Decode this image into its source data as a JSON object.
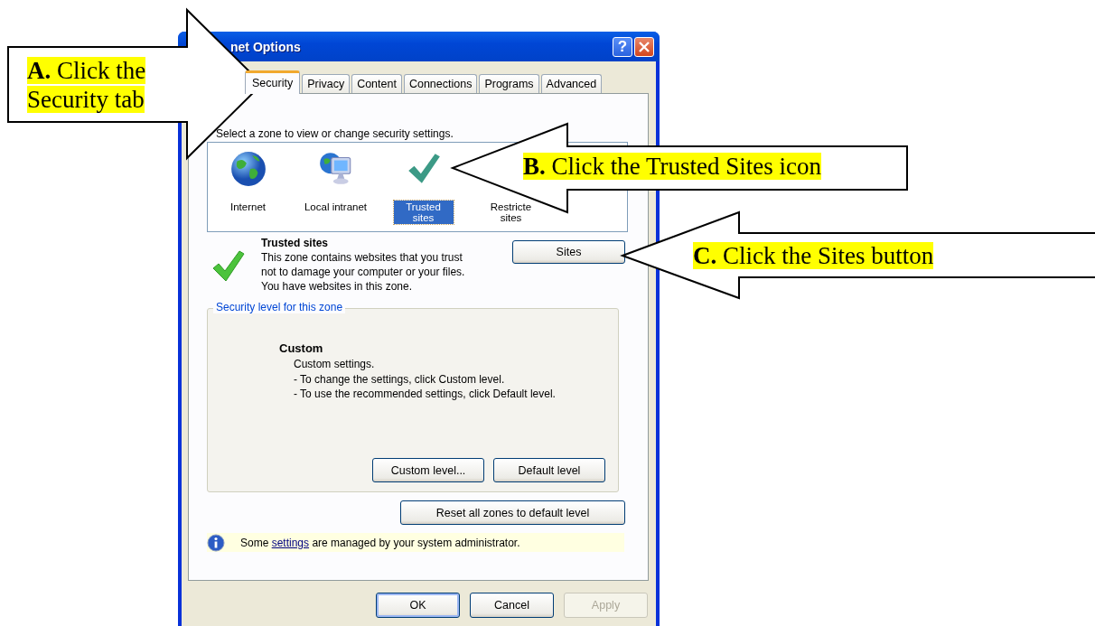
{
  "window": {
    "title": "net Options",
    "help": "?"
  },
  "tabs": [
    {
      "label": "Security",
      "selected": true
    },
    {
      "label": "Privacy",
      "selected": false
    },
    {
      "label": "Content",
      "selected": false
    },
    {
      "label": "Connections",
      "selected": false
    },
    {
      "label": "Programs",
      "selected": false
    },
    {
      "label": "Advanced",
      "selected": false
    }
  ],
  "zone_prompt": "Select a zone to view or change security settings.",
  "zones": [
    {
      "kind": "globe",
      "label": "Internet",
      "selected": false
    },
    {
      "kind": "intranet",
      "label": "Local intranet",
      "selected": false
    },
    {
      "kind": "check",
      "label": "Trusted sites",
      "selected": true
    },
    {
      "kind": "covered",
      "label": "Restricte sites",
      "selected": false
    }
  ],
  "zone_info": {
    "title": "Trusted sites",
    "description": "This zone contains websites that you trust not to damage your computer or your files.",
    "note": "You have websites in this zone.",
    "button": "Sites"
  },
  "security_level": {
    "legend": "Security level for this zone",
    "level_name": "Custom",
    "lines": [
      "Custom settings.",
      "- To change the settings, click Custom level.",
      "- To use the recommended settings, click Default level."
    ],
    "buttons": [
      "Custom level...",
      "Default level"
    ]
  },
  "reset_button": "Reset all zones to default level",
  "info_bar": {
    "before": "Some ",
    "link": "settings",
    "after": " are managed by your system administrator."
  },
  "dialog_buttons": [
    {
      "label": "OK",
      "disabled": false
    },
    {
      "label": "Cancel",
      "disabled": false
    },
    {
      "label": "Apply",
      "disabled": true
    }
  ],
  "callouts": [
    {
      "text": "**A.**  Click the Security tab"
    },
    {
      "text": "**B.**  Click the Trusted Sites icon"
    },
    {
      "text": "**C.**  Click the Sites button"
    }
  ]
}
